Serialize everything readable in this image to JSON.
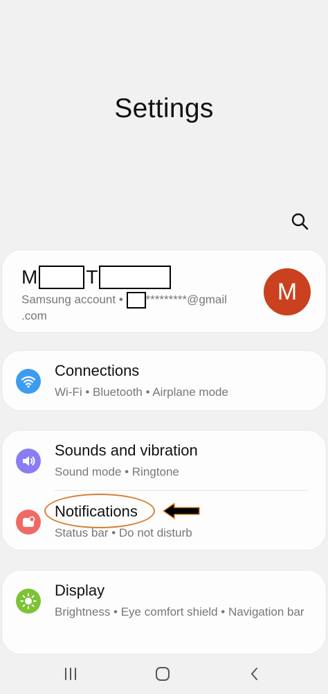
{
  "page": {
    "title": "Settings"
  },
  "account": {
    "name_initial_1": "M",
    "name_initial_2": "T",
    "sub_prefix": "Samsung account",
    "sub_email": "*********@gmail",
    "sub_line2": ".com",
    "avatar_letter": "M",
    "avatar_color": "#c9411f"
  },
  "items": [
    {
      "label": "Connections",
      "sub": "Wi-Fi  •  Bluetooth  •  Airplane mode",
      "icon": "wifi-icon",
      "color": "#3d9cf0"
    },
    {
      "label": "Sounds and vibration",
      "sub": "Sound mode  •  Ringtone",
      "icon": "speaker-icon",
      "color": "#8a7cf2"
    },
    {
      "label": "Notifications",
      "sub": "Status bar  •  Do not disturb",
      "icon": "notification-icon",
      "color": "#f06a65"
    },
    {
      "label": "Display",
      "sub": "Brightness  •  Eye comfort shield  •  Navigation bar",
      "icon": "sun-icon",
      "color": "#7cc335"
    }
  ],
  "annotation": {
    "highlight_color": "#d97c2e",
    "arrow_color": "#000000"
  },
  "navbar": {
    "icons": [
      "recent-apps-icon",
      "home-icon",
      "back-icon"
    ]
  }
}
